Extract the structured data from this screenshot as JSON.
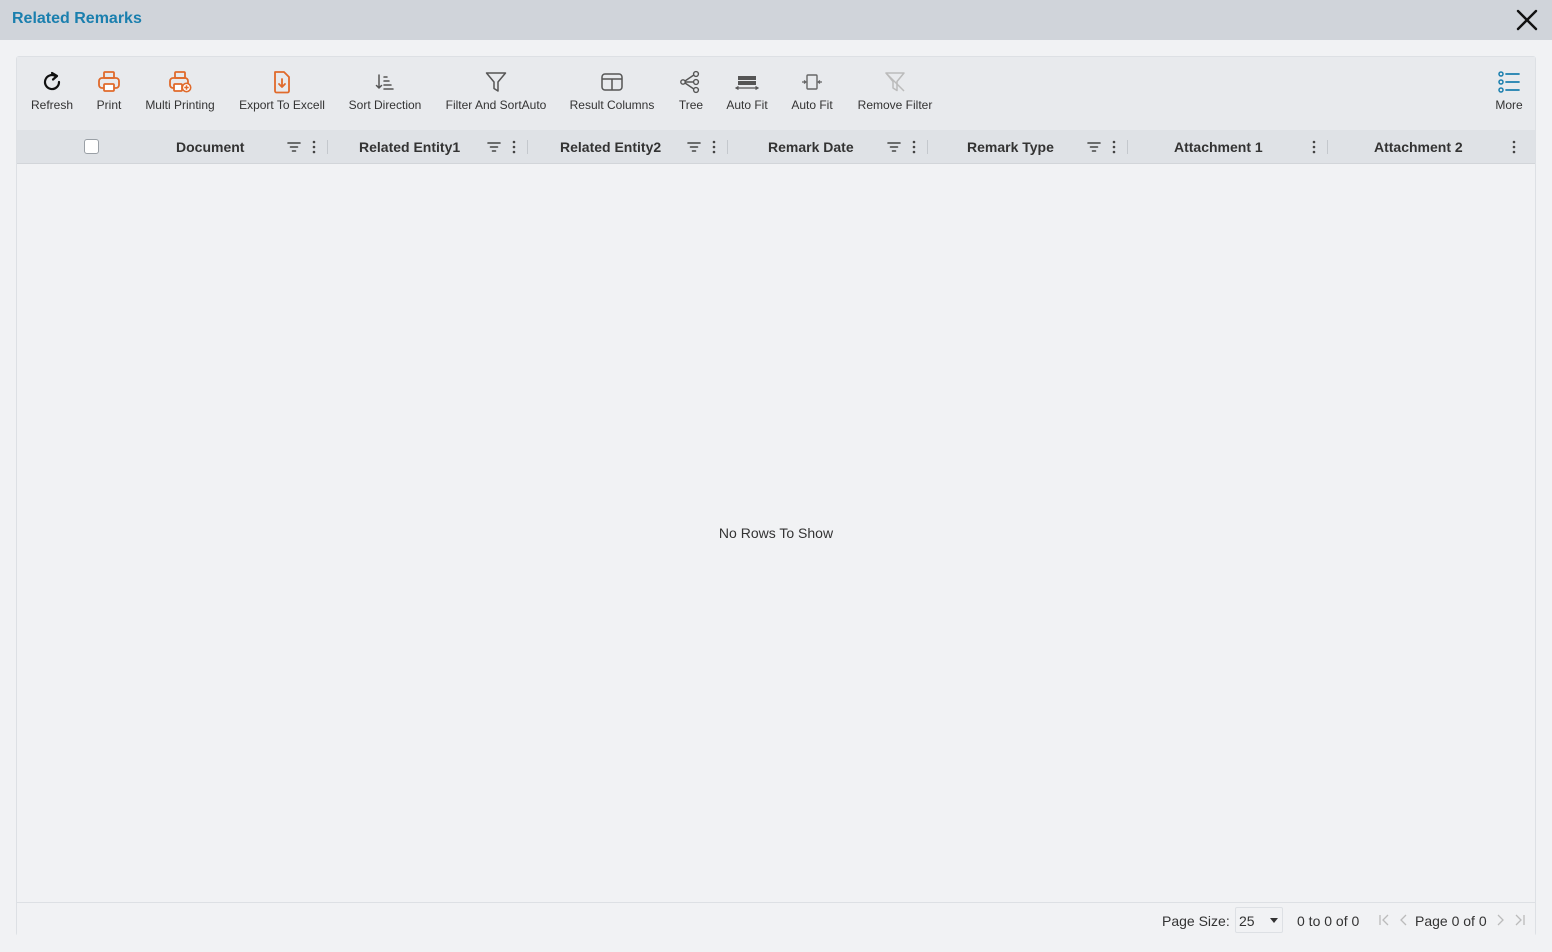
{
  "dialog": {
    "title": "Related Remarks"
  },
  "colors": {
    "accent": "#1a7fae",
    "orange": "#e06a2b",
    "icon_dark": "#555555",
    "icon_disabled": "#bbbbbb"
  },
  "toolbar": {
    "buttons": [
      {
        "label": "Refresh",
        "icon": "refresh-icon"
      },
      {
        "label": "Print",
        "icon": "printer-icon"
      },
      {
        "label": "Multi Printing",
        "icon": "multi-print-icon"
      },
      {
        "label": "Export To Excell",
        "icon": "export-file-icon"
      },
      {
        "label": "Sort Direction",
        "icon": "sort-direction-icon"
      },
      {
        "label": "Filter And SortAuto",
        "icon": "funnel-icon"
      },
      {
        "label": "Result Columns",
        "icon": "columns-icon"
      },
      {
        "label": "Tree",
        "icon": "tree-icon"
      },
      {
        "label": "Auto Fit",
        "icon": "auto-fit-rows-icon"
      },
      {
        "label": "Auto Fit",
        "icon": "auto-fit-columns-icon"
      },
      {
        "label": "Remove Filter",
        "icon": "remove-filter-icon"
      },
      {
        "label": "More",
        "icon": "list-menu-icon"
      }
    ]
  },
  "grid": {
    "columns": [
      {
        "label": "Document",
        "filter": true
      },
      {
        "label": "Related Entity1",
        "filter": true
      },
      {
        "label": "Related Entity2",
        "filter": true
      },
      {
        "label": "Remark Date",
        "filter": true
      },
      {
        "label": "Remark Type",
        "filter": true
      },
      {
        "label": "Attachment 1",
        "filter": false
      },
      {
        "label": "Attachment 2",
        "filter": false
      }
    ],
    "empty_message": "No Rows To Show"
  },
  "pager": {
    "page_size_label": "Page Size:",
    "page_size": "25",
    "range_text": "0 to 0 of 0",
    "page_text": "Page 0 of 0"
  }
}
